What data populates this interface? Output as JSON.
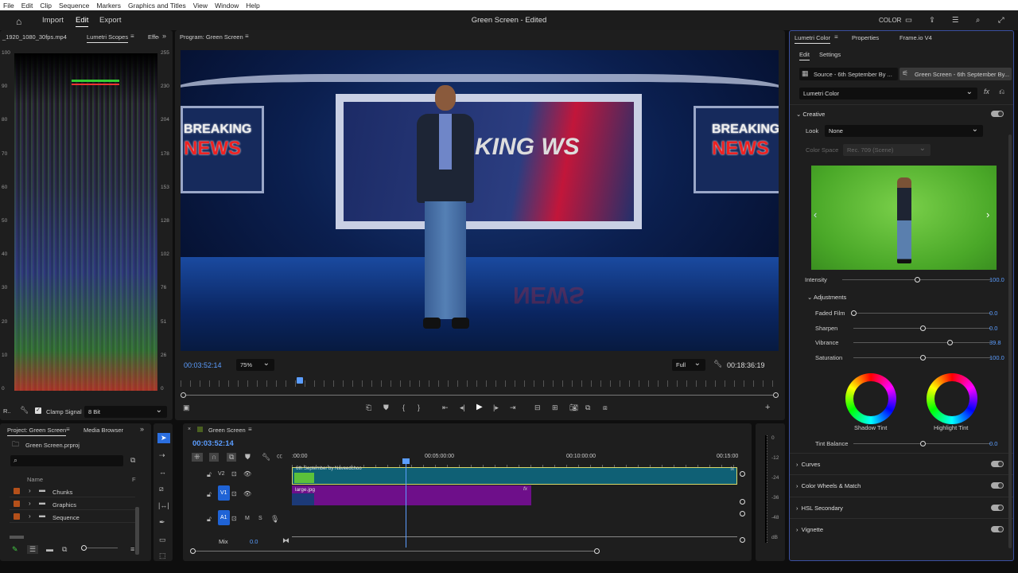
{
  "menu": [
    "File",
    "Edit",
    "Clip",
    "Sequence",
    "Markers",
    "Graphics and Titles",
    "View",
    "Window",
    "Help"
  ],
  "header": {
    "nav": [
      "Import",
      "Edit",
      "Export"
    ],
    "title": "Green Screen - Edited",
    "workspace": "COLOR"
  },
  "scopes": {
    "tabs": [
      "_1920_1080_30fps.mp4",
      "Lumetri Scopes",
      "Effec"
    ],
    "left_scale": [
      "100",
      "90",
      "80",
      "70",
      "60",
      "50",
      "40",
      "30",
      "20",
      "10",
      "0"
    ],
    "right_scale": [
      "255",
      "230",
      "204",
      "178",
      "153",
      "128",
      "102",
      "76",
      "51",
      "26",
      "0"
    ],
    "footer_label": "R..",
    "clamp_label": "Clamp Signal",
    "clamp_checked": true,
    "bit_depth": "8 Bit"
  },
  "program": {
    "tab": "Program: Green Screen",
    "current_time": "00:03:52:14",
    "zoom": "75%",
    "quality": "Full",
    "duration": "00:18:36:19",
    "video_text": {
      "left": "BREAKING NEWS",
      "center": "KING WS",
      "right": "BREAKING NEWS",
      "news": "NEWS"
    },
    "playhead_fraction": 0.2
  },
  "project": {
    "tabs": [
      "Project: Green Screen",
      "Media Browser"
    ],
    "file": "Green Screen.prproj",
    "search_placeholder": "",
    "col_name": "Name",
    "col_f": "F",
    "items": [
      "Chunks",
      "Graphics",
      "Sequence"
    ]
  },
  "timeline": {
    "tab": "Green Screen",
    "timecode": "00:03:52:14",
    "ruler": [
      ":00:00",
      "00:05:00:00",
      "00:10:00:00",
      "00:15:00"
    ],
    "tracks": [
      {
        "name": "V2"
      },
      {
        "name": "V1"
      },
      {
        "name": "A1"
      }
    ],
    "mix_label": "Mix",
    "mix_value": "0.0",
    "clip_v2": "6th September by Naveedchoo",
    "clip_v1": "large.jpg",
    "fx": "fx",
    "meter": [
      "0",
      "-12",
      "-24",
      "-36",
      "-48",
      "dB"
    ]
  },
  "lumetri": {
    "tabs": [
      "Lumetri Color",
      "Properties",
      "Frame.io V4"
    ],
    "subtabs": [
      "Edit",
      "Settings"
    ],
    "source": "Source - 6th September By ...",
    "sequence": "Green Screen - 6th September By...",
    "effect": "Lumetri Color",
    "creative": "Creative",
    "look_label": "Look",
    "look_value": "None",
    "cs_label": "Color Space",
    "cs_value": "Rec. 709 (Scene)",
    "intensity": {
      "label": "Intensity",
      "value": "100.0",
      "fraction": 0.5
    },
    "adjustments": "Adjustments",
    "sliders": [
      {
        "label": "Faded Film",
        "value": "0.0",
        "fraction": 0.0
      },
      {
        "label": "Sharpen",
        "value": "0.0",
        "fraction": 0.5
      },
      {
        "label": "Vibrance",
        "value": "39.8",
        "fraction": 0.7
      },
      {
        "label": "Saturation",
        "value": "100.0",
        "fraction": 0.5
      }
    ],
    "wheels": [
      "Shadow Tint",
      "Highlight Tint"
    ],
    "tint_balance": {
      "label": "Tint Balance",
      "value": "0.0",
      "fraction": 0.5
    },
    "sections": [
      "Curves",
      "Color Wheels & Match",
      "HSL Secondary",
      "Vignette"
    ]
  }
}
